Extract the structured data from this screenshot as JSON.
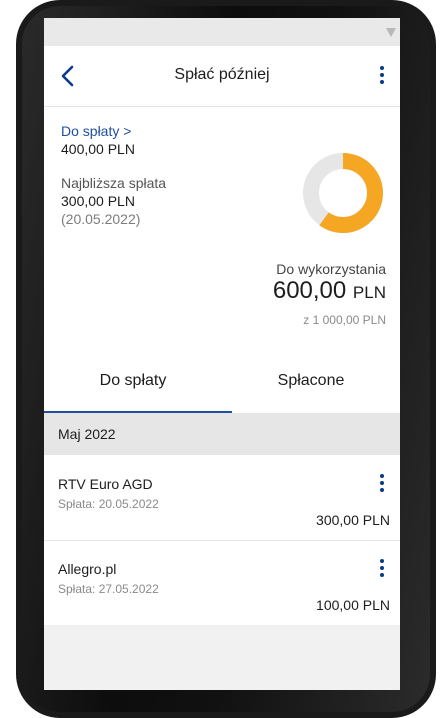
{
  "header": {
    "title": "Spłać później"
  },
  "summary": {
    "to_pay_link": "Do spłaty >",
    "to_pay_amount": "400,00 PLN",
    "next_payment_label": "Najbliższa spłata",
    "next_payment_amount": "300,00 PLN",
    "next_payment_date": "(20.05.2022)",
    "available_label": "Do wykorzystania",
    "available_value": "600,00",
    "available_currency": "PLN",
    "limit_text": "z 1 000,00 PLN",
    "usage_fraction": 0.6,
    "colors": {
      "available": "#f5a623",
      "used": "#e6e6e6",
      "accent": "#1f4fa0"
    }
  },
  "tabs": [
    {
      "label": "Do spłaty",
      "selected": true
    },
    {
      "label": "Spłacone",
      "selected": false
    }
  ],
  "month": {
    "label": "Maj 2022"
  },
  "payments": [
    {
      "merchant": "RTV Euro AGD",
      "due": "Spłata: 20.05.2022",
      "amount": "300,00 PLN"
    },
    {
      "merchant": "Allegro.pl",
      "due": "Spłata: 27.05.2022",
      "amount": "100,00 PLN"
    }
  ]
}
